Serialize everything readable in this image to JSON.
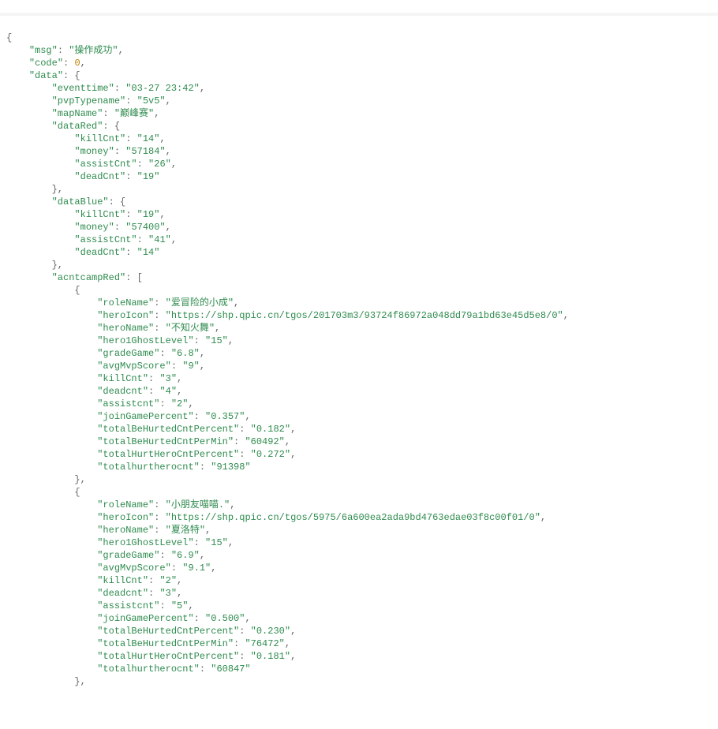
{
  "json": {
    "msg": "操作成功",
    "code": 0,
    "data": {
      "eventtime": "03-27 23:42",
      "pvpTypename": "5v5",
      "mapName": "巅峰赛",
      "dataRed": {
        "killCnt": "14",
        "money": "57184",
        "assistCnt": "26",
        "deadCnt": "19"
      },
      "dataBlue": {
        "killCnt": "19",
        "money": "57400",
        "assistCnt": "41",
        "deadCnt": "14"
      },
      "acntcampRed": [
        {
          "roleName": "爱冒险的小成",
          "heroIcon": "https://shp.qpic.cn/tgos/201703m3/93724f86972a048dd79a1bd63e45d5e8/0",
          "heroName": "不知火舞",
          "hero1GhostLevel": "15",
          "gradeGame": "6.8",
          "avgMvpScore": "9",
          "killCnt": "3",
          "deadcnt": "4",
          "assistcnt": "2",
          "joinGamePercent": "0.357",
          "totalBeHurtedCntPercent": "0.182",
          "totalBeHurtedCntPerMin": "60492",
          "totalHurtHeroCntPercent": "0.272",
          "totalhurtherocnt": "91398"
        },
        {
          "roleName": "小朋友喵喵.",
          "heroIcon": "https://shp.qpic.cn/tgos/5975/6a600ea2ada9bd4763edae03f8c00f01/0",
          "heroName": "夏洛特",
          "hero1GhostLevel": "15",
          "gradeGame": "6.9",
          "avgMvpScore": "9.1",
          "killCnt": "2",
          "deadcnt": "3",
          "assistcnt": "5",
          "joinGamePercent": "0.500",
          "totalBeHurtedCntPercent": "0.230",
          "totalBeHurtedCntPerMin": "76472",
          "totalHurtHeroCntPercent": "0.181",
          "totalhurtherocnt": "60847"
        }
      ]
    }
  }
}
